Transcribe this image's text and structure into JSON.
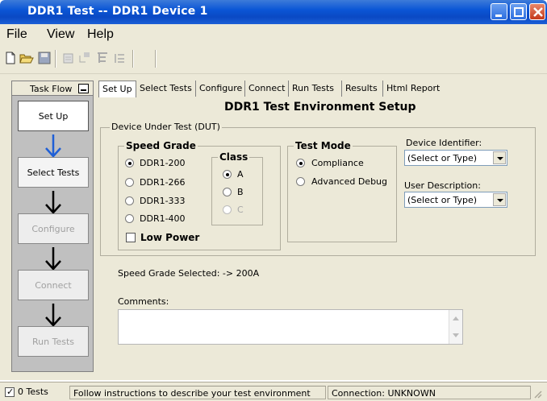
{
  "window": {
    "title": "DDR1 Test -- DDR1 Device 1"
  },
  "menu": {
    "file": "File",
    "view": "View",
    "help": "Help"
  },
  "toolbar": {
    "icons": [
      "new-icon",
      "open-icon",
      "save-icon",
      "report-icon",
      "add-icon",
      "tree-icon",
      "list-icon"
    ]
  },
  "taskflow": {
    "header": "Task Flow",
    "steps": [
      {
        "label": "Set Up",
        "state": "active"
      },
      {
        "label": "Select Tests",
        "state": "enabled"
      },
      {
        "label": "Configure",
        "state": "disabled"
      },
      {
        "label": "Connect",
        "state": "disabled"
      },
      {
        "label": "Run Tests",
        "state": "disabled"
      }
    ],
    "arrow_colors": [
      "#1f5fd6",
      "#000000",
      "#000000",
      "#000000"
    ]
  },
  "tabs": [
    "Set Up",
    "Select Tests",
    "Configure",
    "Connect",
    "Run Tests",
    "Results",
    "Html Report"
  ],
  "setup": {
    "page_title": "DDR1 Test Environment Setup",
    "dut_group": "Device Under Test (DUT)",
    "speed_grade": {
      "legend": "Speed Grade",
      "options": [
        "DDR1-200",
        "DDR1-266",
        "DDR1-333",
        "DDR1-400"
      ],
      "selected": "DDR1-200"
    },
    "class": {
      "legend": "Class",
      "options": [
        "A",
        "B",
        "C"
      ],
      "selected": "A"
    },
    "low_power": {
      "label": "Low Power",
      "checked": false
    },
    "test_mode": {
      "legend": "Test Mode",
      "options": [
        "Compliance",
        "Advanced Debug"
      ],
      "selected": "Compliance"
    },
    "device_identifier": {
      "label": "Device Identifier:",
      "value": "(Select or Type)"
    },
    "user_description": {
      "label": "User Description:",
      "value": "(Select or Type)"
    },
    "speed_grade_selected": "Speed Grade Selected: -> 200A",
    "comments_label": "Comments:"
  },
  "status": {
    "tests_checkbox": "0 Tests",
    "message": "Follow instructions to describe your test environment",
    "connection": "Connection: UNKNOWN"
  }
}
